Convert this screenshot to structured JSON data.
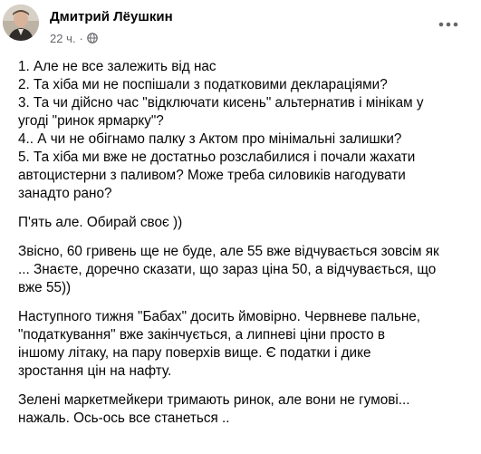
{
  "post": {
    "author": "Дмитрий Лёушкин",
    "time": "22 ч.",
    "dot": "·",
    "icons": {
      "privacy": "globe-icon",
      "menu": "more-options-icon"
    }
  },
  "content": {
    "p1": [
      "1. Але не все залежить від нас",
      "2. Та хіба ми не поспішали з податковими деклараціями?",
      "3. Та чи дійсно час \"відключати кисень\" альтернатив і мінікам у",
      "угоді \"ринок ярмарку\"?",
      "4.. А чи не обігнамо палку з Актом про мінімальні залишки?",
      "5. Та хіба ми вже не достатньо розслабилися і почали жахати",
      "автоцистерни з паливом? Може треба силовиків нагодувати",
      "занадто рано?"
    ],
    "p2": [
      "П'ять але. Обирай своє ))"
    ],
    "p3": [
      "Звісно, 60 гривень ще не буде, але 55 вже відчувається зовсім як",
      "... Знаєте, доречно сказати, що зараз ціна 50, а відчувається, що",
      "вже 55))"
    ],
    "p4": [
      "Наступного тижня \"Бабах\" досить ймовірно. Червневе пальне,",
      "\"податкування\" вже закінчується, а липневі ціни просто в",
      "іншому літаку, на пару поверхів вище. Є податки і дике",
      "зростання цін на нафту."
    ],
    "p5": [
      "Зелені маркетмейкери тримають ринок, але вони не гумові...",
      "нажаль. Ось-ось все станеться .."
    ]
  }
}
